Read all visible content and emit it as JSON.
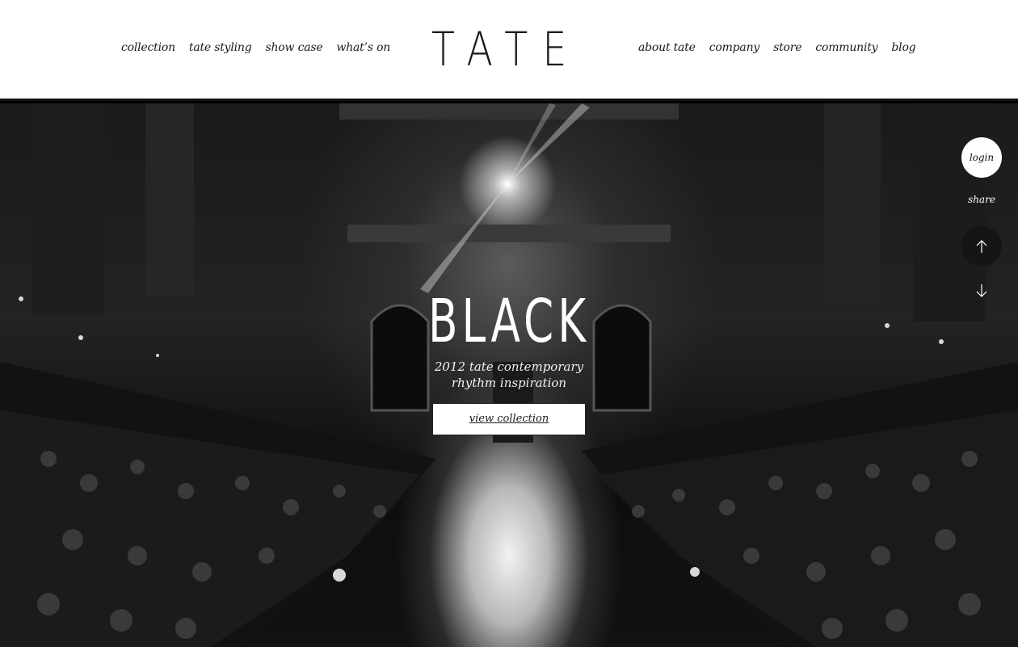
{
  "header": {
    "logo": "TATE",
    "nav_left": [
      "collection",
      "tate styling",
      "show case",
      "what’s on"
    ],
    "nav_right": [
      "about tate",
      "company",
      "store",
      "community",
      "blog"
    ]
  },
  "hero": {
    "title": "BLACK",
    "subtitle_line1": "2012 tate contemporary",
    "subtitle_line2": "rhythm inspiration",
    "button_label": "view collection"
  },
  "side": {
    "login_label": "login",
    "share_label": "share",
    "up_icon": "arrow-up-icon",
    "down_icon": "arrow-down-icon"
  },
  "colors": {
    "header_bg": "#ffffff",
    "text_dark": "#1a1a1a",
    "hero_bg": "#111111",
    "accent_white": "#ffffff"
  }
}
